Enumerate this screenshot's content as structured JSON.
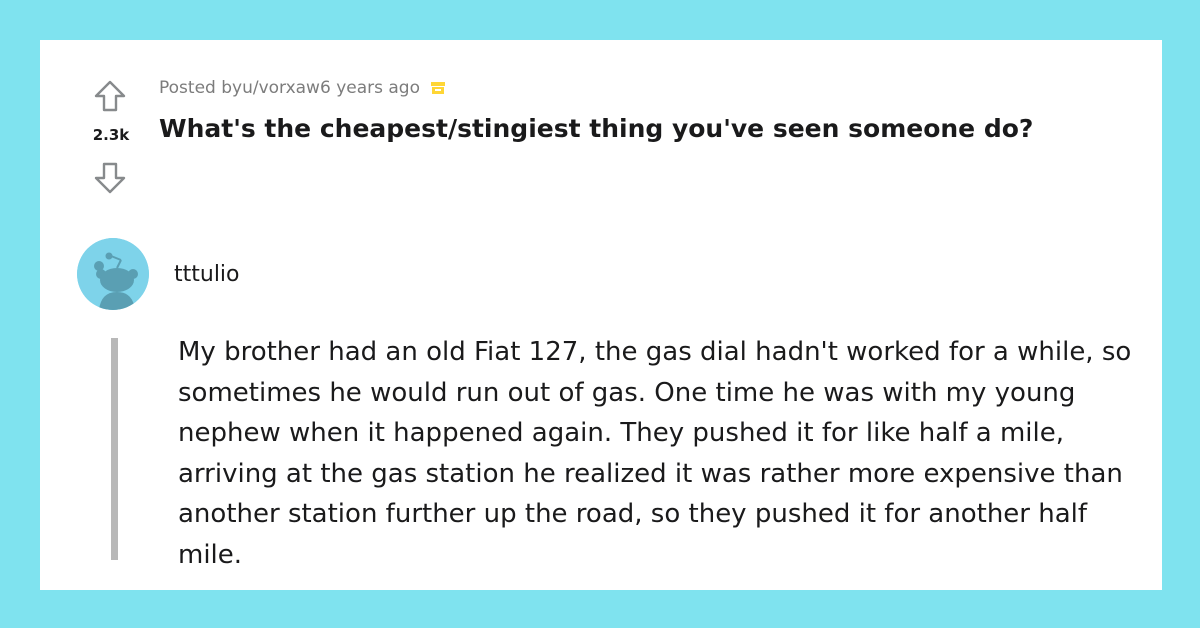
{
  "post": {
    "meta_prefix": "Posted by ",
    "author": "u/vorxaw",
    "time": " 6 years ago",
    "vote_count": "2.3k",
    "title": "What's the cheapest/stingiest thing you've seen someone do?",
    "archived_icon": "archive-icon"
  },
  "comment": {
    "author": "tttulio",
    "avatar_icon": "snoo-avatar-icon",
    "avatar_color": "#7ed3ea",
    "body": "My brother had an old Fiat 127, the gas dial hadn't worked for a while, so sometimes he would run out of gas. One time he was with my young nephew when it happened again. They pushed it for like half a mile, arriving at the gas station he realized it was rather more expensive than another station further up the road, so they pushed it for another half mile."
  },
  "colors": {
    "background": "#7fe3ef",
    "card": "#ffffff",
    "archive": "#ffd635",
    "thread_line": "#b8b8b8"
  }
}
